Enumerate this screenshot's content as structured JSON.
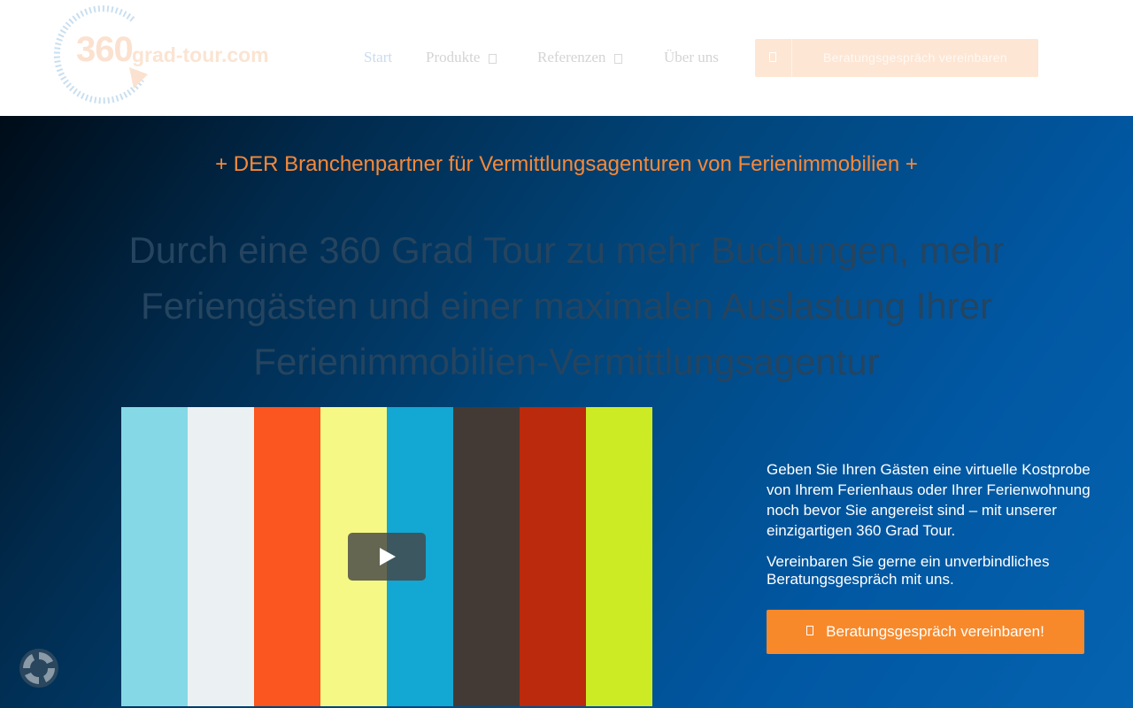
{
  "header": {
    "logo": {
      "prefix": "360",
      "rest": "grad-tour.com"
    },
    "nav": [
      {
        "label": "Start",
        "has_caret": false,
        "active": true
      },
      {
        "label": "Produkte",
        "has_caret": true,
        "active": false
      },
      {
        "label": "Referenzen",
        "has_caret": true,
        "active": false
      },
      {
        "label": "Über uns",
        "has_caret": false,
        "active": false
      }
    ],
    "cta_label": "Beratungsgespräch vereinbaren"
  },
  "hero": {
    "tagline": "+ DER Branchenpartner für Vermittlungsagenturen von Ferienimmobilien +",
    "headline": "Durch eine 360 Grad Tour zu mehr Buchungen, mehr Feriengästen und einer maximalen Auslastung Ihrer Ferienimmobilien-Vermittlungsagentur",
    "video": {
      "play_icon": "play-icon",
      "bar_colors": [
        "#85d9e6",
        "#ebf0f2",
        "#fb5520",
        "#f5f884",
        "#13a7d3",
        "#433a35",
        "#bb2a0c",
        "#cdeb24"
      ]
    },
    "paragraph_1": "Geben Sie Ihren Gästen eine virtuelle Kostprobe von Ihrem Ferienhaus oder Ihrer Ferienwohnung noch bevor Sie angereist sind – mit unserer einzigartigen 360 Grad Tour.",
    "paragraph_2": "Vereinbaren Sie gerne ein unverbindliches Beratungsgespräch mit uns.",
    "cta_label": "Beratungsgespräch vereinbaren!"
  },
  "colors": {
    "accent": "#f7892b",
    "tagline": "#f5893a",
    "headline": "#25445f"
  },
  "cookie_widget": {
    "icon": "cookie-settings-icon"
  }
}
